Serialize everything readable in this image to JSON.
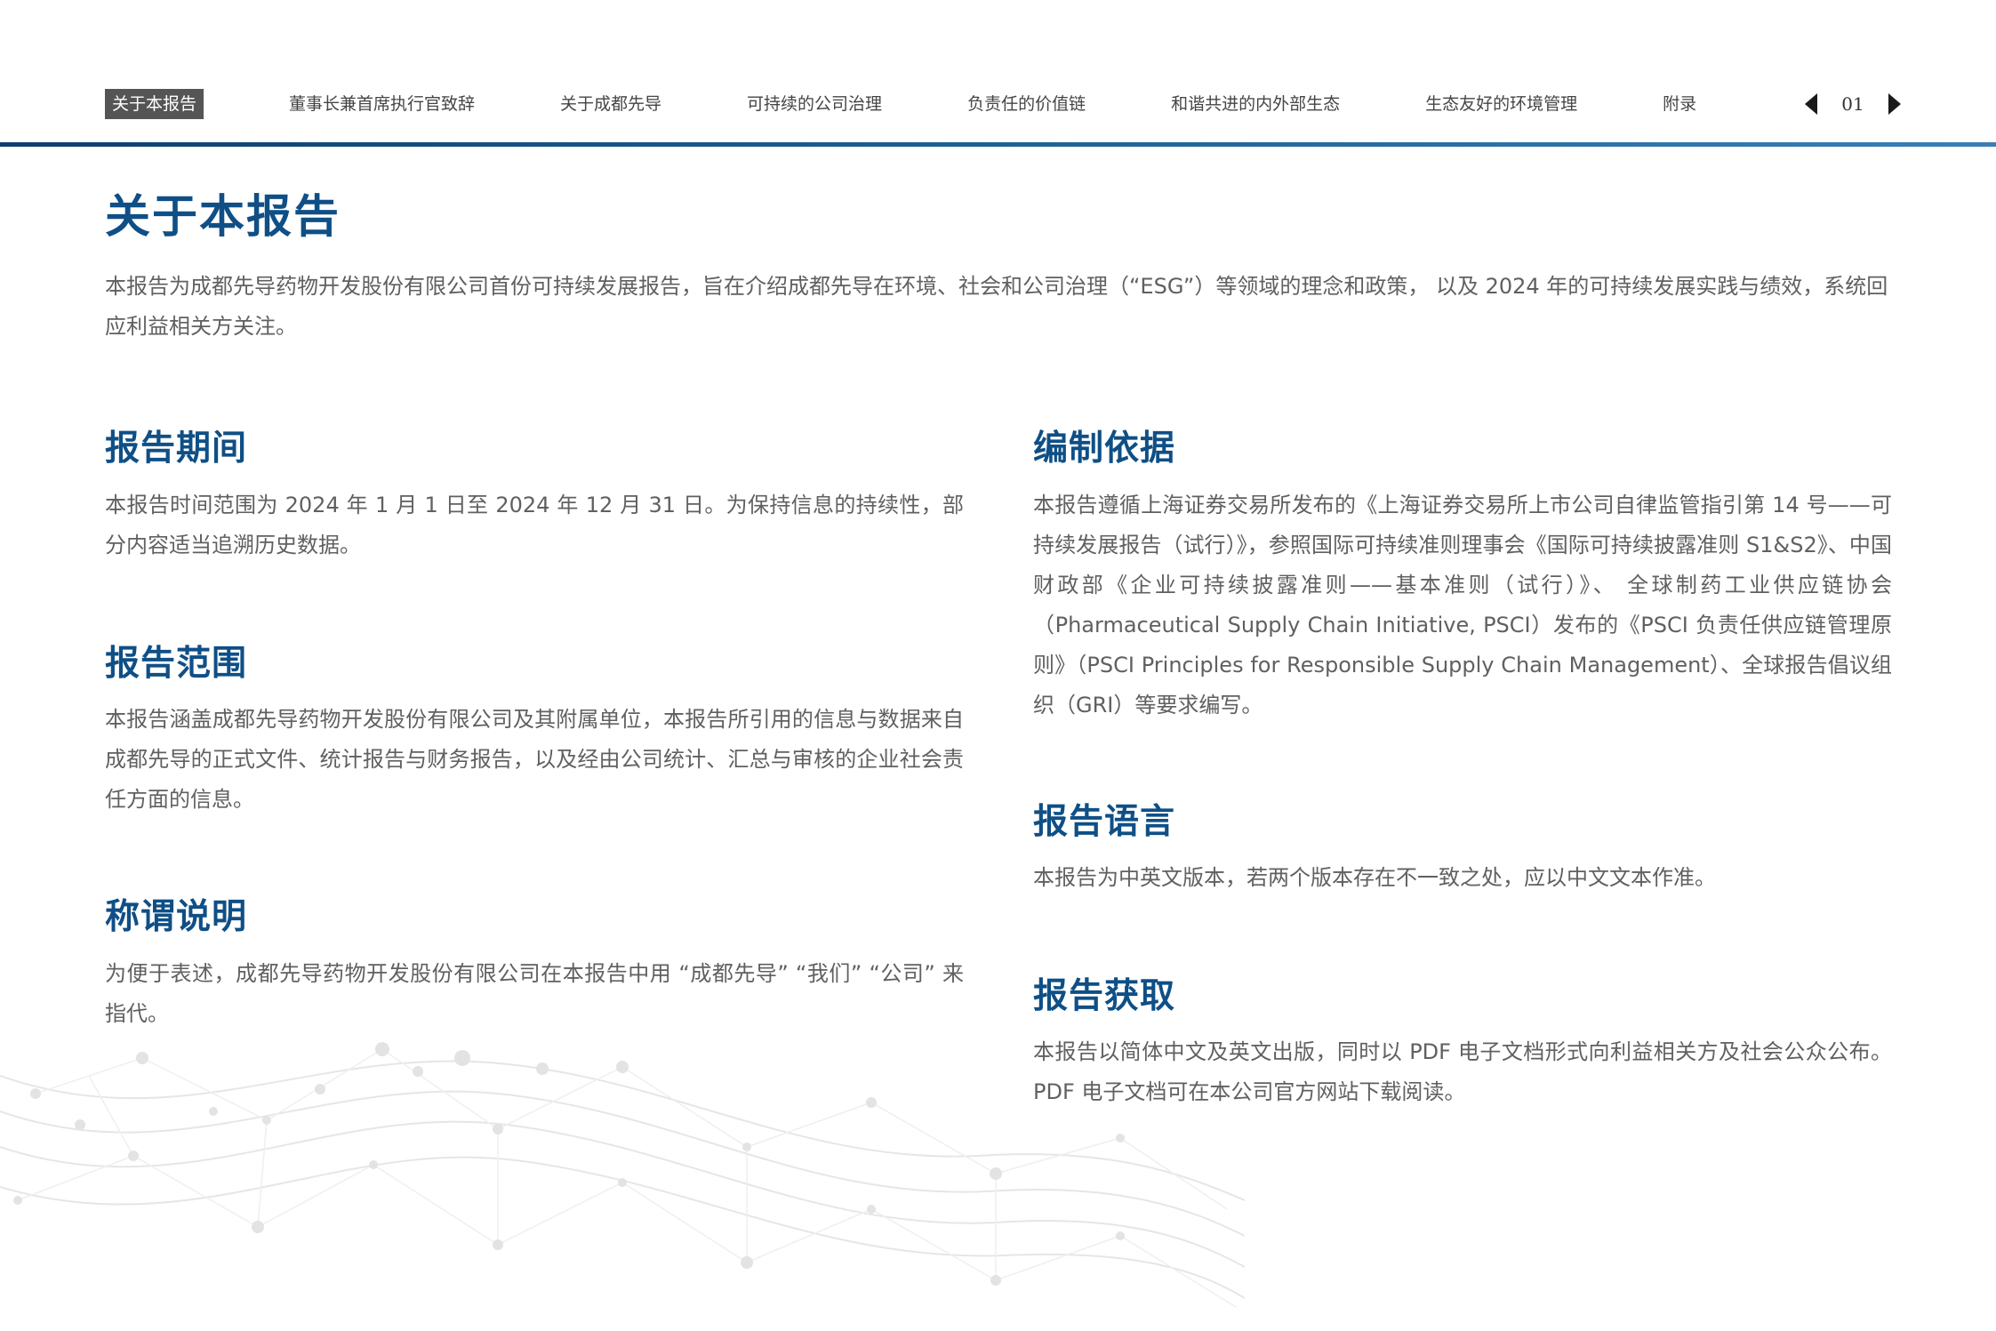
{
  "nav": {
    "items": [
      {
        "label": "关于本报告"
      },
      {
        "label": "董事长兼首席执行官致辞"
      },
      {
        "label": "关于成都先导"
      },
      {
        "label": "可持续的公司治理"
      },
      {
        "label": "负责任的价值链"
      },
      {
        "label": "和谐共进的内外部生态"
      },
      {
        "label": "生态友好的环境管理"
      },
      {
        "label": "附录"
      }
    ],
    "page_number": "01",
    "prev_icon": "triangle-left",
    "next_icon": "triangle-right"
  },
  "colors": {
    "accent": "#0f4f86",
    "rule_start": "#0d3e6e",
    "rule_end": "#3a7fb5",
    "active_tab_bg": "#555555"
  },
  "main": {
    "title": "关于本报告",
    "intro": "本报告为成都先导药物开发股份有限公司首份可持续发展报告，旨在介绍成都先导在环境、社会和公司治理（“ESG”）等领域的理念和政策， 以及 2024 年的可持续发展实践与绩效，系统回应利益相关方关注。"
  },
  "sections": {
    "period": {
      "title": "报告期间",
      "body": "本报告时间范围为 2024 年 1 月 1 日至 2024 年 12 月 31 日。为保持信息的持续性，部分内容适当追溯历史数据。"
    },
    "scope": {
      "title": "报告范围",
      "body": "本报告涵盖成都先导药物开发股份有限公司及其附属单位，本报告所引用的信息与数据来自成都先导的正式文件、统计报告与财务报告，以及经由公司统计、汇总与审核的企业社会责任方面的信息。"
    },
    "naming": {
      "title": "称谓说明",
      "body": "为便于表述，成都先导药物开发股份有限公司在本报告中用 “成都先导” “我们” “公司” 来指代。"
    },
    "basis": {
      "title": "编制依据",
      "body": "本报告遵循上海证券交易所发布的《上海证券交易所上市公司自律监管指引第 14 号——可持续发展报告（试行）》，参照国际可持续准则理事会《国际可持续披露准则 S1&S2》、中国财政部《企业可持续披露准则——基本准则（试行）》、 全球制药工业供应链协会（Pharmaceutical Supply Chain Initiative, PSCI）发布的《PSCI 负责任供应链管理原则》（PSCI Principles for Responsible Supply Chain Management）、全球报告倡议组织（GRI）等要求编写。"
    },
    "language": {
      "title": "报告语言",
      "body": "本报告为中英文版本，若两个版本存在不一致之处，应以中文文本作准。"
    },
    "access": {
      "title": "报告获取",
      "body": "本报告以简体中文及英文出版，同时以 PDF 电子文档形式向利益相关方及社会公众公布。PDF 电子文档可在本公司官方网站下载阅读。"
    }
  }
}
